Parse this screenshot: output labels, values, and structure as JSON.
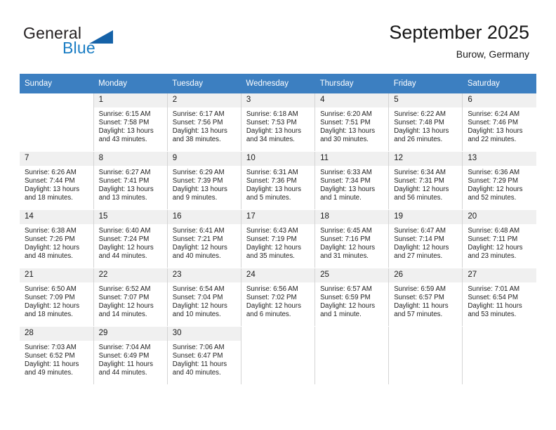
{
  "brand": {
    "name_part1": "General",
    "name_part2": "Blue"
  },
  "header": {
    "title": "September 2025",
    "location": "Burow, Germany"
  },
  "weekday_headers": [
    "Sunday",
    "Monday",
    "Tuesday",
    "Wednesday",
    "Thursday",
    "Friday",
    "Saturday"
  ],
  "colors": {
    "header_bar": "#3c7fc1",
    "daynum_bg": "#f0f0f0",
    "brand_blue": "#1a7dc4",
    "triangle_blue": "#1562a8",
    "grid_line": "#d4d4d4"
  },
  "weeks": [
    [
      {
        "day": "",
        "blank": true
      },
      {
        "day": "1",
        "sunrise": "Sunrise: 6:15 AM",
        "sunset": "Sunset: 7:58 PM",
        "daylight1": "Daylight: 13 hours",
        "daylight2": "and 43 minutes."
      },
      {
        "day": "2",
        "sunrise": "Sunrise: 6:17 AM",
        "sunset": "Sunset: 7:56 PM",
        "daylight1": "Daylight: 13 hours",
        "daylight2": "and 38 minutes."
      },
      {
        "day": "3",
        "sunrise": "Sunrise: 6:18 AM",
        "sunset": "Sunset: 7:53 PM",
        "daylight1": "Daylight: 13 hours",
        "daylight2": "and 34 minutes."
      },
      {
        "day": "4",
        "sunrise": "Sunrise: 6:20 AM",
        "sunset": "Sunset: 7:51 PM",
        "daylight1": "Daylight: 13 hours",
        "daylight2": "and 30 minutes."
      },
      {
        "day": "5",
        "sunrise": "Sunrise: 6:22 AM",
        "sunset": "Sunset: 7:48 PM",
        "daylight1": "Daylight: 13 hours",
        "daylight2": "and 26 minutes."
      },
      {
        "day": "6",
        "sunrise": "Sunrise: 6:24 AM",
        "sunset": "Sunset: 7:46 PM",
        "daylight1": "Daylight: 13 hours",
        "daylight2": "and 22 minutes."
      }
    ],
    [
      {
        "day": "7",
        "sunrise": "Sunrise: 6:26 AM",
        "sunset": "Sunset: 7:44 PM",
        "daylight1": "Daylight: 13 hours",
        "daylight2": "and 18 minutes."
      },
      {
        "day": "8",
        "sunrise": "Sunrise: 6:27 AM",
        "sunset": "Sunset: 7:41 PM",
        "daylight1": "Daylight: 13 hours",
        "daylight2": "and 13 minutes."
      },
      {
        "day": "9",
        "sunrise": "Sunrise: 6:29 AM",
        "sunset": "Sunset: 7:39 PM",
        "daylight1": "Daylight: 13 hours",
        "daylight2": "and 9 minutes."
      },
      {
        "day": "10",
        "sunrise": "Sunrise: 6:31 AM",
        "sunset": "Sunset: 7:36 PM",
        "daylight1": "Daylight: 13 hours",
        "daylight2": "and 5 minutes."
      },
      {
        "day": "11",
        "sunrise": "Sunrise: 6:33 AM",
        "sunset": "Sunset: 7:34 PM",
        "daylight1": "Daylight: 13 hours",
        "daylight2": "and 1 minute."
      },
      {
        "day": "12",
        "sunrise": "Sunrise: 6:34 AM",
        "sunset": "Sunset: 7:31 PM",
        "daylight1": "Daylight: 12 hours",
        "daylight2": "and 56 minutes."
      },
      {
        "day": "13",
        "sunrise": "Sunrise: 6:36 AM",
        "sunset": "Sunset: 7:29 PM",
        "daylight1": "Daylight: 12 hours",
        "daylight2": "and 52 minutes."
      }
    ],
    [
      {
        "day": "14",
        "sunrise": "Sunrise: 6:38 AM",
        "sunset": "Sunset: 7:26 PM",
        "daylight1": "Daylight: 12 hours",
        "daylight2": "and 48 minutes."
      },
      {
        "day": "15",
        "sunrise": "Sunrise: 6:40 AM",
        "sunset": "Sunset: 7:24 PM",
        "daylight1": "Daylight: 12 hours",
        "daylight2": "and 44 minutes."
      },
      {
        "day": "16",
        "sunrise": "Sunrise: 6:41 AM",
        "sunset": "Sunset: 7:21 PM",
        "daylight1": "Daylight: 12 hours",
        "daylight2": "and 40 minutes."
      },
      {
        "day": "17",
        "sunrise": "Sunrise: 6:43 AM",
        "sunset": "Sunset: 7:19 PM",
        "daylight1": "Daylight: 12 hours",
        "daylight2": "and 35 minutes."
      },
      {
        "day": "18",
        "sunrise": "Sunrise: 6:45 AM",
        "sunset": "Sunset: 7:16 PM",
        "daylight1": "Daylight: 12 hours",
        "daylight2": "and 31 minutes."
      },
      {
        "day": "19",
        "sunrise": "Sunrise: 6:47 AM",
        "sunset": "Sunset: 7:14 PM",
        "daylight1": "Daylight: 12 hours",
        "daylight2": "and 27 minutes."
      },
      {
        "day": "20",
        "sunrise": "Sunrise: 6:48 AM",
        "sunset": "Sunset: 7:11 PM",
        "daylight1": "Daylight: 12 hours",
        "daylight2": "and 23 minutes."
      }
    ],
    [
      {
        "day": "21",
        "sunrise": "Sunrise: 6:50 AM",
        "sunset": "Sunset: 7:09 PM",
        "daylight1": "Daylight: 12 hours",
        "daylight2": "and 18 minutes."
      },
      {
        "day": "22",
        "sunrise": "Sunrise: 6:52 AM",
        "sunset": "Sunset: 7:07 PM",
        "daylight1": "Daylight: 12 hours",
        "daylight2": "and 14 minutes."
      },
      {
        "day": "23",
        "sunrise": "Sunrise: 6:54 AM",
        "sunset": "Sunset: 7:04 PM",
        "daylight1": "Daylight: 12 hours",
        "daylight2": "and 10 minutes."
      },
      {
        "day": "24",
        "sunrise": "Sunrise: 6:56 AM",
        "sunset": "Sunset: 7:02 PM",
        "daylight1": "Daylight: 12 hours",
        "daylight2": "and 6 minutes."
      },
      {
        "day": "25",
        "sunrise": "Sunrise: 6:57 AM",
        "sunset": "Sunset: 6:59 PM",
        "daylight1": "Daylight: 12 hours",
        "daylight2": "and 1 minute."
      },
      {
        "day": "26",
        "sunrise": "Sunrise: 6:59 AM",
        "sunset": "Sunset: 6:57 PM",
        "daylight1": "Daylight: 11 hours",
        "daylight2": "and 57 minutes."
      },
      {
        "day": "27",
        "sunrise": "Sunrise: 7:01 AM",
        "sunset": "Sunset: 6:54 PM",
        "daylight1": "Daylight: 11 hours",
        "daylight2": "and 53 minutes."
      }
    ],
    [
      {
        "day": "28",
        "sunrise": "Sunrise: 7:03 AM",
        "sunset": "Sunset: 6:52 PM",
        "daylight1": "Daylight: 11 hours",
        "daylight2": "and 49 minutes."
      },
      {
        "day": "29",
        "sunrise": "Sunrise: 7:04 AM",
        "sunset": "Sunset: 6:49 PM",
        "daylight1": "Daylight: 11 hours",
        "daylight2": "and 44 minutes."
      },
      {
        "day": "30",
        "sunrise": "Sunrise: 7:06 AM",
        "sunset": "Sunset: 6:47 PM",
        "daylight1": "Daylight: 11 hours",
        "daylight2": "and 40 minutes."
      },
      {
        "day": "",
        "blank": true
      },
      {
        "day": "",
        "blank": true
      },
      {
        "day": "",
        "blank": true
      },
      {
        "day": "",
        "blank": true
      }
    ]
  ]
}
